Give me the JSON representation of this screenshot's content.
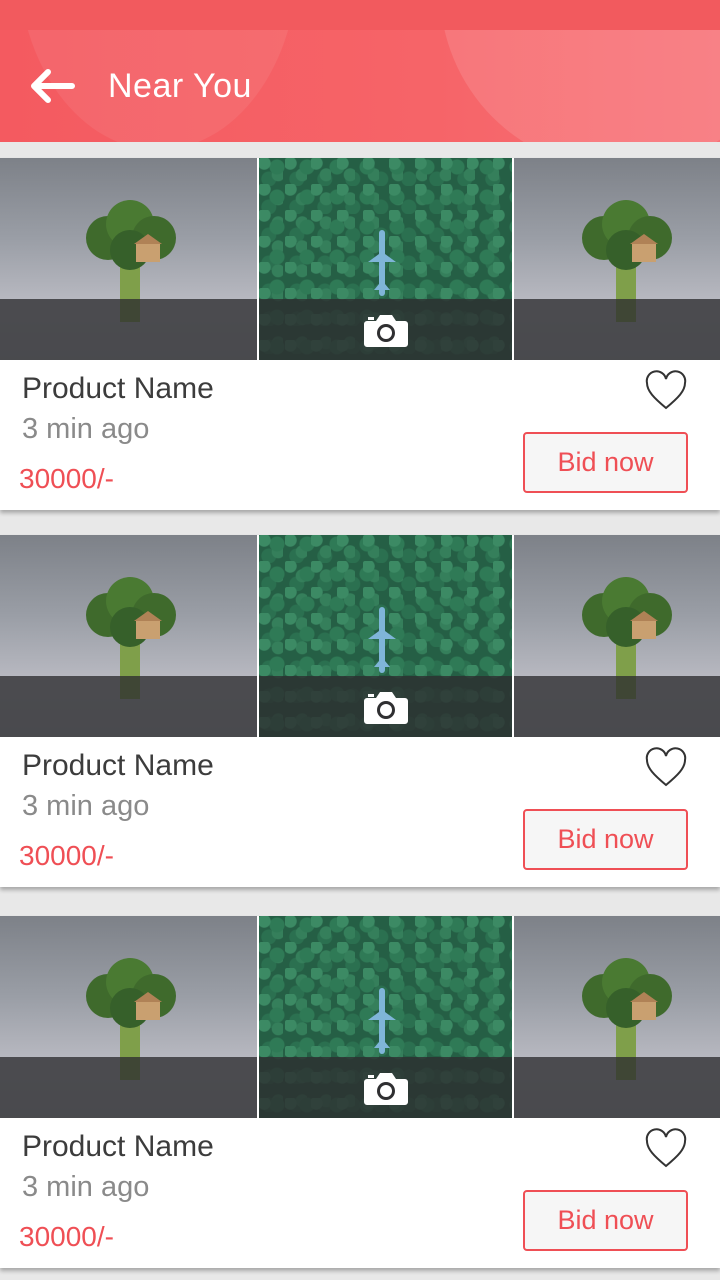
{
  "header": {
    "title": "Near You",
    "back_icon": "arrow-left-icon"
  },
  "colors": {
    "accent": "#ef4f55",
    "header": "#f45a60"
  },
  "products": [
    {
      "name": "Product Name",
      "time": "3 min ago",
      "price": "30000/-",
      "bid_label": "Bid now"
    },
    {
      "name": "Product Name",
      "time": "3 min ago",
      "price": "30000/-",
      "bid_label": "Bid now"
    },
    {
      "name": "Product Name",
      "time": "3 min ago",
      "price": "30000/-",
      "bid_label": "Bid now"
    }
  ]
}
